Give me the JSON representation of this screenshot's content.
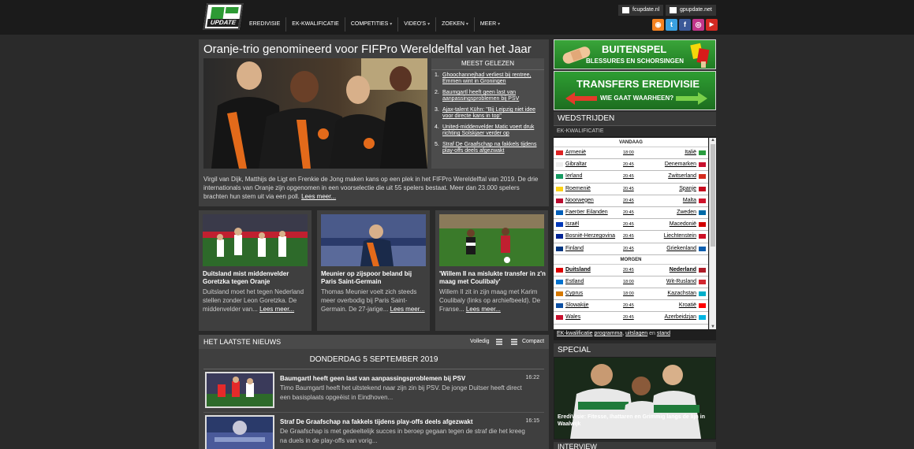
{
  "logo": {
    "text": "UPDATE"
  },
  "sites": [
    "fcupdate.nl",
    "gpupdate.net"
  ],
  "nav": [
    {
      "label": "EREDIVISIE",
      "dropdown": false
    },
    {
      "label": "EK-KWALIFICATIE",
      "dropdown": false
    },
    {
      "label": "COMPETITIES",
      "dropdown": true
    },
    {
      "label": "VIDEO'S",
      "dropdown": true
    },
    {
      "label": "ZOEKEN",
      "dropdown": true
    },
    {
      "label": "MEER",
      "dropdown": true
    }
  ],
  "social": [
    {
      "name": "rss-icon",
      "glyph": "◉",
      "color": "#f58220"
    },
    {
      "name": "twitter-icon",
      "glyph": "t",
      "color": "#3aa0e0"
    },
    {
      "name": "facebook-icon",
      "glyph": "f",
      "color": "#3b5998"
    },
    {
      "name": "instagram-icon",
      "glyph": "◎",
      "color": "#c1358a"
    },
    {
      "name": "youtube-icon",
      "glyph": "▶",
      "color": "#d42a22"
    }
  ],
  "feature": {
    "title": "Oranje-trio genomineerd voor FIFPro Wereldelftal van het Jaar",
    "text": "Virgil van Dijk, Matthijs de Ligt en Frenkie de Jong maken kans op een plek in het FIFPro Wereldelftal van 2019. De drie internationals van Oranje zijn opgenomen in een voorselectie die uit 55 spelers bestaat. Meer dan 23.000 spelers brachten hun stem uit via een poll.",
    "more": "Lees meer...",
    "popular_title": "MEEST GELEZEN",
    "popular": [
      {
        "num": "1.",
        "text": "Ghoochannejhad verliest bij rentree, Emmen wint in Groningen"
      },
      {
        "num": "2.",
        "text": "Baumgartl heeft geen last van aanpassingsproblemen bij PSV"
      },
      {
        "num": "3.",
        "text": "Ajax-talent Kühn: \"Bij Leipzig niet idee voor directe kans in top\""
      },
      {
        "num": "4.",
        "text": "United-middenvelder Matic voert druk richting Solskjaer verder op"
      },
      {
        "num": "5.",
        "text": "Straf De Graafschap na fakkels tijdens play-offs deels afgezwakt"
      }
    ]
  },
  "cards": [
    {
      "title": "Duitsland mist middenvelder Goretzka tegen Oranje",
      "text": "Duitsland moet het tegen Nederland stellen zonder Leon Goretzka. De middenvelder van...",
      "more": "Lees meer..."
    },
    {
      "title": "Meunier op zijspoor beland bij Paris Saint-Germain",
      "text": "Thomas Meunier voelt zich steeds meer overbodig bij Paris Saint-Germain. De 27-jarige...",
      "more": "Lees meer..."
    },
    {
      "title": "'Willem II na mislukte transfer in z'n maag met Coulibaly'",
      "text": "Willem II zit in zijn maag met Karim Coulibaly (links op archiefbeeld). De Franse...",
      "more": "Lees meer..."
    }
  ],
  "news": {
    "title": "HET LAATSTE NIEUWS",
    "mode_full": "Volledig",
    "mode_compact": "Compact",
    "date": "DONDERDAG 5 SEPTEMBER 2019",
    "items": [
      {
        "title": "Baumgartl heeft geen last van aanpassingsproblemen bij PSV",
        "time": "16:22",
        "text": "Timo Baumgartl heeft het uitstekend naar zijn zin bij PSV. De jonge Duitser heeft direct een basisplaats opgeëist in Eindhoven..."
      },
      {
        "title": "Straf De Graafschap na fakkels tijdens play-offs deels afgezwakt",
        "time": "16:15",
        "text": "De Graafschap is met gedeeltelijk succes in beroep gegaan tegen de straf die het kreeg na duels in de play-offs van vorig..."
      }
    ]
  },
  "banner1": {
    "title": "BUITENSPEL",
    "sub": "BLESSURES EN SCHORSINGEN"
  },
  "banner2": {
    "title": "TRANSFERS EREDIVISIE",
    "sub": "WIE GAAT WAARHEEN?"
  },
  "matches": {
    "title": "WEDSTRIJDEN",
    "sub": "EK-KWALIFICATIE",
    "today_label": "VANDAAG",
    "tomorrow_label": "MORGEN",
    "today": [
      {
        "home": "Armenië",
        "time": "18:00",
        "away": "Italië",
        "hf": "#d22",
        "af": "#2a9d3f"
      },
      {
        "home": "Gibraltar",
        "time": "20:45",
        "away": "Denemarken",
        "hf": "#eee",
        "af": "#c8102e"
      },
      {
        "home": "Ierland",
        "time": "20:45",
        "away": "Zwitserland",
        "hf": "#169b62",
        "af": "#d52b1e"
      },
      {
        "home": "Roemenië",
        "time": "20:45",
        "away": "Spanje",
        "hf": "#fcd116",
        "af": "#c60b1e"
      },
      {
        "home": "Noorwegen",
        "time": "20:45",
        "away": "Malta",
        "hf": "#ba0c2f",
        "af": "#cf142b"
      },
      {
        "home": "Faeröer Eilanden",
        "time": "20:45",
        "away": "Zweden",
        "hf": "#005eb8",
        "af": "#006aa7"
      },
      {
        "home": "Israël",
        "time": "20:45",
        "away": "Macedonië",
        "hf": "#0038b8",
        "af": "#d20000"
      },
      {
        "home": "Bosnië-Herzegovina",
        "time": "20:45",
        "away": "Liechtenstein",
        "hf": "#002395",
        "af": "#ce1126"
      },
      {
        "home": "Finland",
        "time": "20:45",
        "away": "Griekenland",
        "hf": "#003580",
        "af": "#0d5eaf"
      }
    ],
    "tomorrow": [
      {
        "home": "Duitsland",
        "time": "20:45",
        "away": "Nederland",
        "hf": "#dd0000",
        "af": "#ae1c28",
        "bold": true
      },
      {
        "home": "Estland",
        "time": "18:00",
        "away": "Wit-Rusland",
        "hf": "#0072ce",
        "af": "#d22730"
      },
      {
        "home": "Cyprus",
        "time": "18:00",
        "away": "Kazachstan",
        "hf": "#d57800",
        "af": "#00afca"
      },
      {
        "home": "Slowakije",
        "time": "20:45",
        "away": "Kroatië",
        "hf": "#0b4ea2",
        "af": "#ff0000"
      },
      {
        "home": "Wales",
        "time": "20:45",
        "away": "Azerbeidzjan",
        "hf": "#c8102e",
        "af": "#00b5e2"
      }
    ],
    "foot_1": "EK-kwalificatie",
    "foot_2": "programma",
    "foot_3": "uitslagen",
    "foot_4": "stand"
  },
  "special": {
    "title": "SPECIAL",
    "caption": "ErediVisie: Fitesse, Ihattaren en Grimmig langs de lijn in Waalwijk"
  },
  "interview": {
    "title": "INTERVIEW"
  }
}
